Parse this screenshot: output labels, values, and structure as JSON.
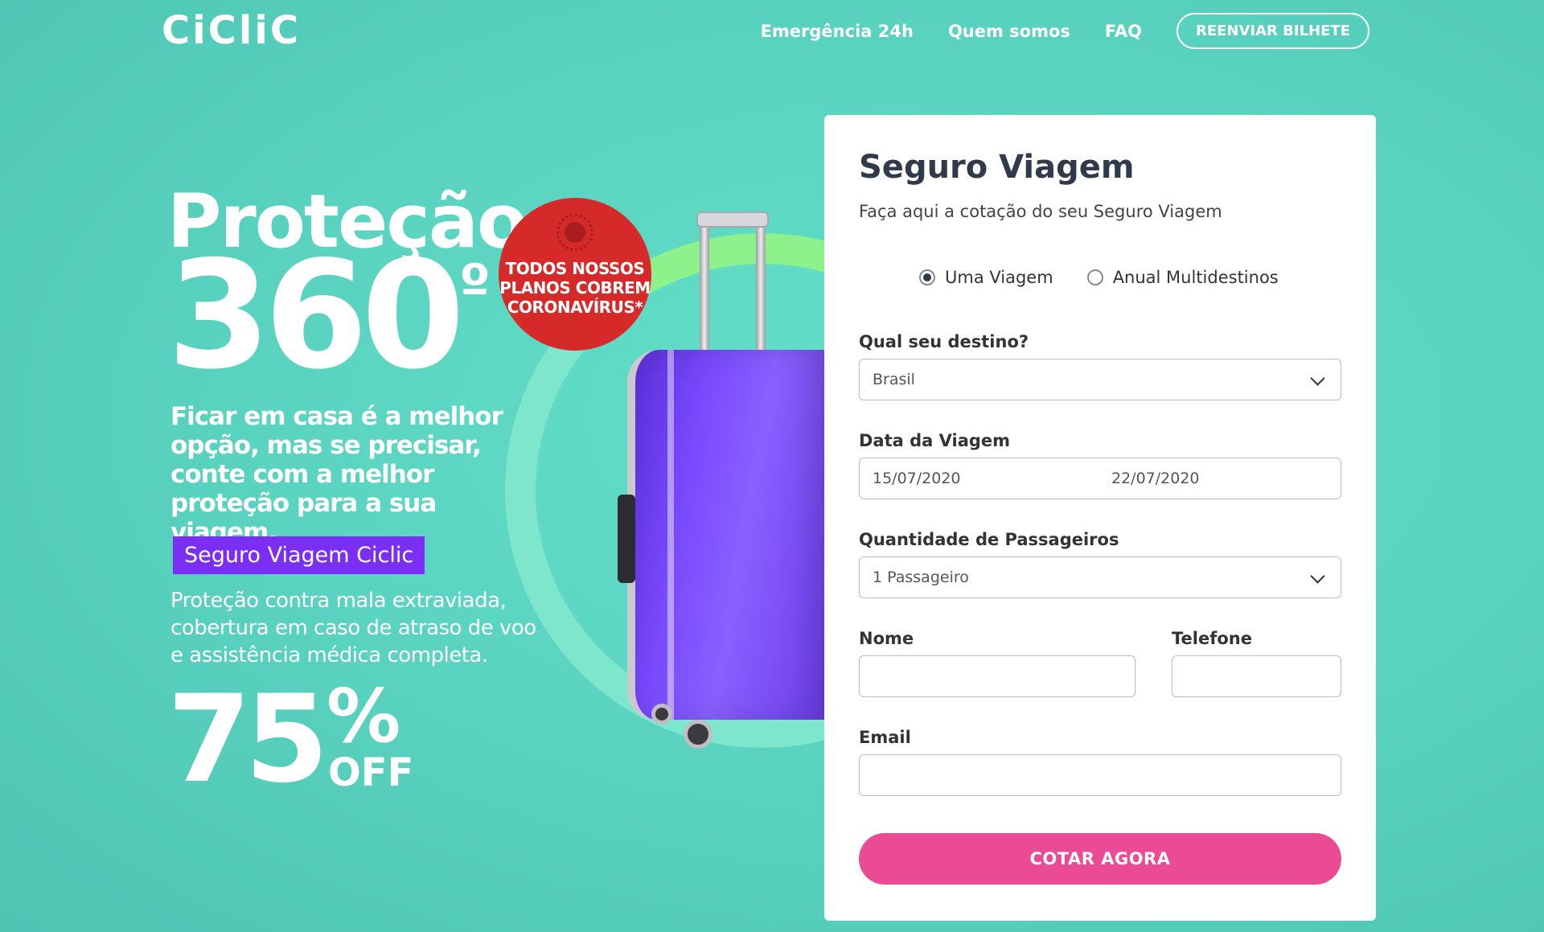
{
  "header": {
    "logo": "CiCliC",
    "nav": [
      "Emergência 24h",
      "Quem somos",
      "FAQ"
    ],
    "resend_label": "REENVIAR BILHETE"
  },
  "hero": {
    "title": "Proteção",
    "big": "360",
    "degree": "º",
    "subtitle": "Ficar em casa é a melhor opção, mas se precisar, conte com a melhor proteção para a sua viagem.",
    "tag": "Seguro Viagem Ciclic",
    "description": "Proteção contra mala extraviada, cobertura em caso de atraso de voo e assistência médica completa.",
    "discount_number": "75",
    "discount_percent": "%",
    "discount_off": "OFF",
    "corona_badge": "TODOS NOSSOS PLANOS COBREM CORONAVÍRUS*"
  },
  "form": {
    "title": "Seguro Viagem",
    "lead": "Faça aqui a cotação do seu Seguro Viagem",
    "trip_type": {
      "options": [
        "Uma Viagem",
        "Anual Multidestinos"
      ],
      "selected": "Uma Viagem"
    },
    "destination": {
      "label": "Qual seu destino?",
      "value": "Brasil"
    },
    "dates": {
      "label": "Data da Viagem",
      "start": "15/07/2020",
      "end": "22/07/2020"
    },
    "passengers": {
      "label": "Quantidade de Passageiros",
      "value": "1 Passageiro"
    },
    "name": {
      "label": "Nome",
      "value": ""
    },
    "phone": {
      "label": "Telefone",
      "value": ""
    },
    "email": {
      "label": "Email",
      "value": ""
    },
    "submit_label": "COTAR AGORA"
  },
  "colors": {
    "background": "#5cd6c2",
    "accent_purple": "#7b2ff5",
    "cta_pink": "#eb4b95",
    "badge_red": "#d62a2a",
    "title_dark": "#2f3a4d"
  }
}
